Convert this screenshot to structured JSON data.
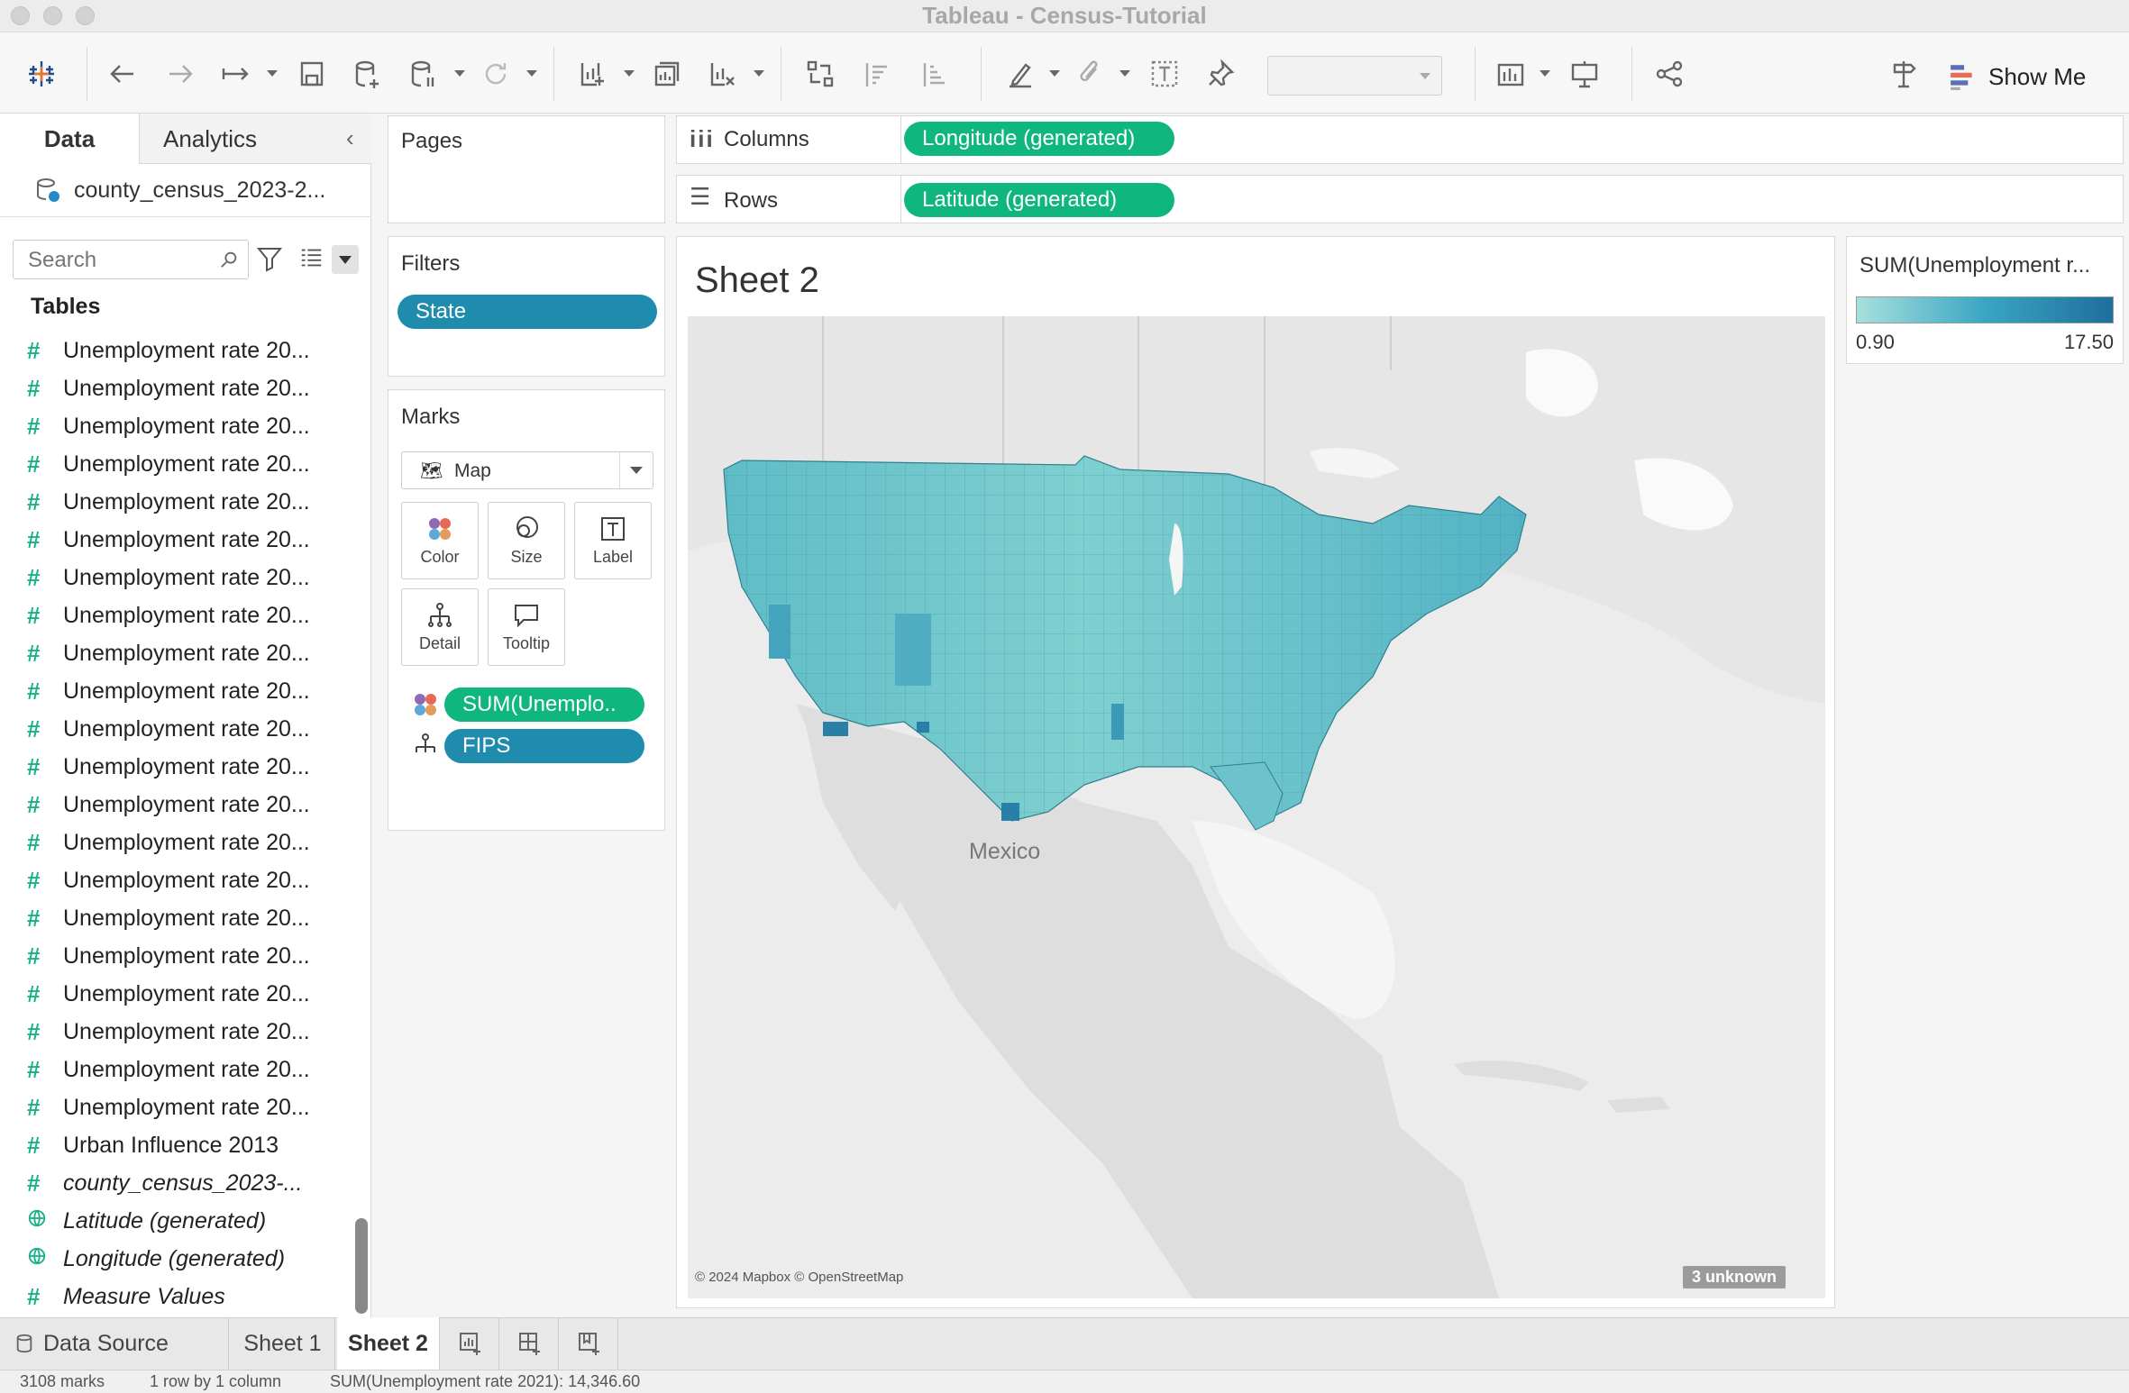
{
  "window": {
    "title": "Tableau - Census-Tutorial"
  },
  "toolbar": {
    "show_me": "Show Me"
  },
  "data_pane": {
    "tab_data": "Data",
    "tab_analytics": "Analytics",
    "datasource": "county_census_2023-2...",
    "search_placeholder": "Search",
    "tables_heading": "Tables",
    "fields": [
      "Unemployment rate 20...",
      "Unemployment rate 20...",
      "Unemployment rate 20...",
      "Unemployment rate 20...",
      "Unemployment rate 20...",
      "Unemployment rate 20...",
      "Unemployment rate 20...",
      "Unemployment rate 20...",
      "Unemployment rate 20...",
      "Unemployment rate 20...",
      "Unemployment rate 20...",
      "Unemployment rate 20...",
      "Unemployment rate 20...",
      "Unemployment rate 20...",
      "Unemployment rate 20...",
      "Unemployment rate 20...",
      "Unemployment rate 20...",
      "Unemployment rate 20...",
      "Unemployment rate 20...",
      "Unemployment rate 20...",
      "Unemployment rate 20...",
      "Urban Influence 2013"
    ],
    "generated_fields": [
      {
        "label": "county_census_2023-...",
        "icon": "hash"
      },
      {
        "label": "Latitude (generated)",
        "icon": "globe"
      },
      {
        "label": "Longitude (generated)",
        "icon": "globe"
      },
      {
        "label": "Measure Values",
        "icon": "hash"
      }
    ]
  },
  "shelves": {
    "pages": "Pages",
    "filters": "Filters",
    "filter_state": "State",
    "marks": "Marks",
    "mark_type": "Map",
    "cards": {
      "color": "Color",
      "size": "Size",
      "label": "Label",
      "detail": "Detail",
      "tooltip": "Tooltip"
    },
    "mark_color_pill": "SUM(Unemplo..",
    "mark_detail_pill": "FIPS",
    "columns_label": "Columns",
    "columns_pill": "Longitude (generated)",
    "rows_label": "Rows",
    "rows_pill": "Latitude (generated)"
  },
  "view": {
    "title": "Sheet 2",
    "map_label_mexico": "Mexico",
    "attribution": "© 2024 Mapbox © OpenStreetMap",
    "unknown_badge": "3 unknown"
  },
  "legend": {
    "title": "SUM(Unemployment r...",
    "min": "0.90",
    "max": "17.50",
    "color_low": "#a7e0dc",
    "color_high": "#1f6e9c"
  },
  "tabs": {
    "data_source": "Data Source",
    "sheet1": "Sheet 1",
    "sheet2": "Sheet 2"
  },
  "status": {
    "marks": "3108 marks",
    "layout": "1 row by 1 column",
    "sum": "SUM(Unemployment rate 2021): 14,346.60"
  }
}
